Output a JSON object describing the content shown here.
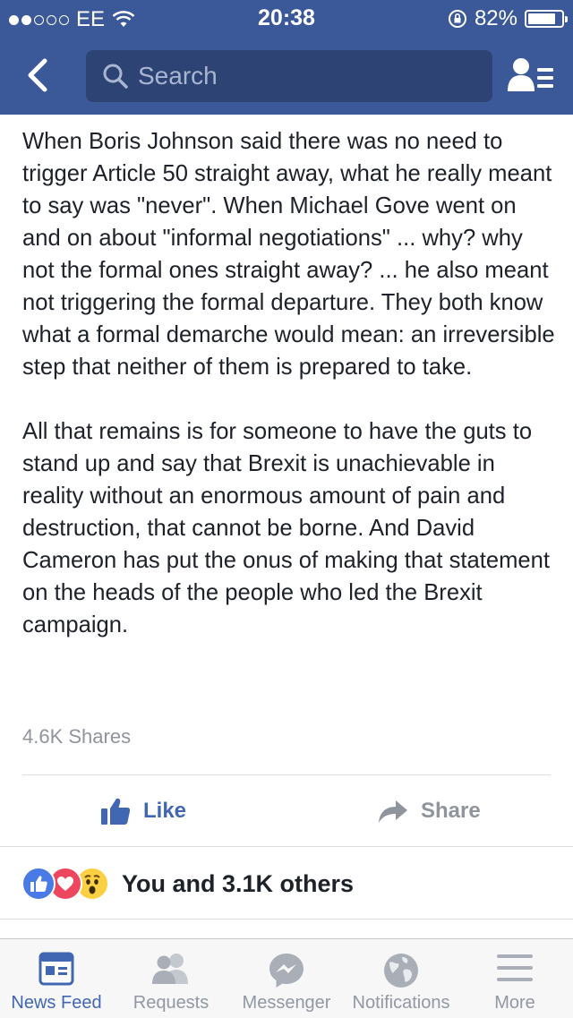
{
  "status_bar": {
    "carrier": "EE",
    "time": "20:38",
    "battery": "82%",
    "battery_level": 0.82
  },
  "nav": {
    "search_placeholder": "Search",
    "icons": [
      "back-chevron-icon",
      "search-icon",
      "friends-list-icon"
    ]
  },
  "post": {
    "paragraphs": [
      "When Boris Johnson said there was no need to trigger Article 50 straight away, what he really meant to say was \"never\". When Michael Gove went on and on about \"informal negotiations\" ... why? why not the formal ones straight away? ... he also meant not triggering the formal departure. They both know what a formal demarche would mean: an irreversible step that neither of them is prepared to take.",
      "All that remains is for someone to have the guts to stand up and say that Brexit is unachievable in reality without an enormous amount of pain and destruction, that cannot be borne. And David Cameron has put the onus of making that statement on the heads of the people who led the Brexit campaign."
    ],
    "shares": "4.6K Shares"
  },
  "actions": {
    "like": "Like",
    "share": "Share"
  },
  "reactions": {
    "summary": "You and 3.1K others",
    "types": [
      "like",
      "love",
      "wow"
    ]
  },
  "tabbar": {
    "items": [
      {
        "label": "News Feed",
        "icon": "news-feed-icon",
        "active": true
      },
      {
        "label": "Requests",
        "icon": "requests-icon",
        "active": false
      },
      {
        "label": "Messenger",
        "icon": "messenger-icon",
        "active": false
      },
      {
        "label": "Notifications",
        "icon": "notifications-globe-icon",
        "active": false
      },
      {
        "label": "More",
        "icon": "menu-icon",
        "active": false
      }
    ]
  },
  "colors": {
    "brand": "#3b5998",
    "accent": "#4267b2",
    "muted": "#90949c"
  }
}
